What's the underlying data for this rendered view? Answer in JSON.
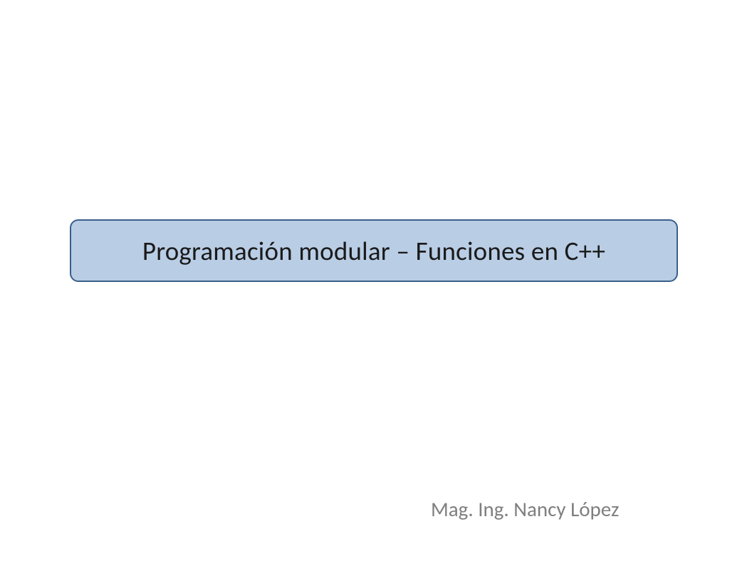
{
  "slide": {
    "title": "Programación modular – Funciones en C++",
    "author": "Mag. Ing. Nancy López"
  },
  "colors": {
    "title_bg": "#b9cde5",
    "title_border": "#3a5f8a",
    "author_text": "#7f7f7f"
  }
}
